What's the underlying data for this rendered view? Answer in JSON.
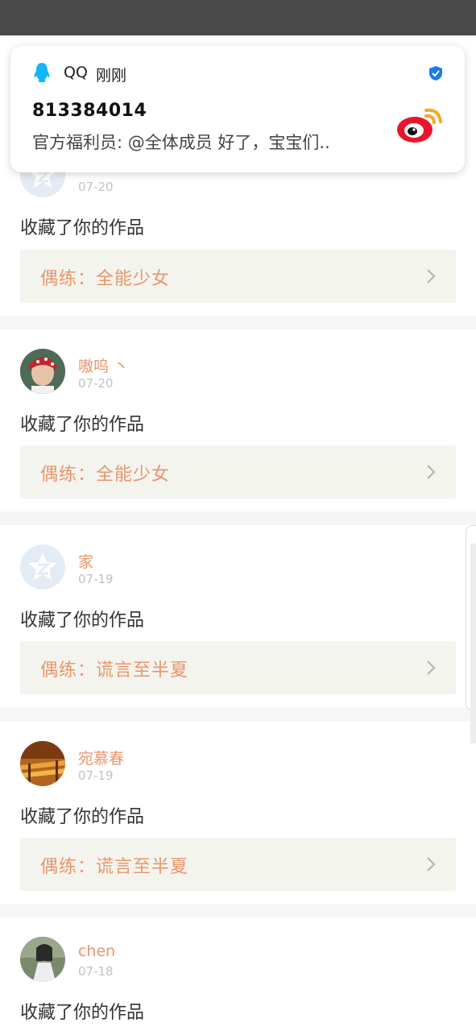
{
  "notification": {
    "app_name": "QQ",
    "time": "刚刚",
    "title": "813384014",
    "body": "官方福利员: @全体成员 好了，宝宝们.."
  },
  "feed": [
    {
      "username": "",
      "date": "07-20",
      "action": "收藏了你的作品",
      "work": "偶练：全能少女",
      "avatar": "default-avatar"
    },
    {
      "username": "嗷呜 丶",
      "date": "07-20",
      "action": "收藏了你的作品",
      "work": "偶练：全能少女",
      "avatar": "photo-avatar"
    },
    {
      "username": "家",
      "date": "07-19",
      "action": "收藏了你的作品",
      "work": "偶练：谎言至半夏",
      "avatar": "default-avatar"
    },
    {
      "username": "宛慕春",
      "date": "07-19",
      "action": "收藏了你的作品",
      "work": "偶练：谎言至半夏",
      "avatar": "photo-avatar"
    },
    {
      "username": "chen",
      "date": "07-18",
      "action": "收藏了你的作品",
      "work": "",
      "avatar": "photo-avatar"
    }
  ],
  "colors": {
    "accent": "#e9956a",
    "status_bar": "#4a4a4a",
    "work_bg": "#f4f4ee"
  }
}
